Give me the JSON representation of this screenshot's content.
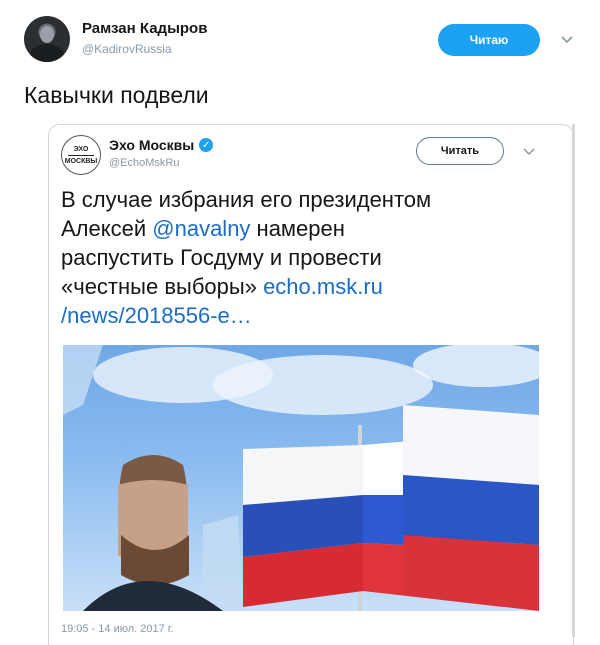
{
  "outer": {
    "name": "Рамзан Кадыров",
    "handle": "@KadirovRussia",
    "follow_label": "Читаю",
    "text": "Кавычки подвели"
  },
  "quote": {
    "logo_top": "ЭХО",
    "logo_bottom": "МОСКВЫ",
    "name": "Эхо Москвы",
    "handle": "@EchoMskRu",
    "read_label": "Читать",
    "text_1": "В случае избрания его президентом",
    "text_2a": "Алексей ",
    "mention": "@navalny",
    "text_2b": " намерен",
    "text_3": "распустить Госдуму и провести",
    "text_4a": "«честные выборы» ",
    "link_a": "echo.msk.ru",
    "link_b": "/news/2018556-e…",
    "timestamp": "19:05 - 14 июл. 2017 г."
  },
  "colors": {
    "accent": "#1da1f2",
    "link": "#1b6cc7",
    "muted": "#8899a6"
  },
  "icons": [
    "chevron-down-icon",
    "verified-icon"
  ]
}
